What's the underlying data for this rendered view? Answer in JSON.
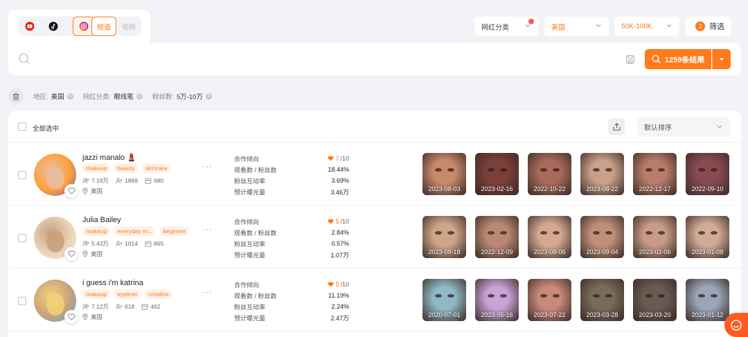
{
  "platforms": [
    {
      "name": "youtube-icon",
      "active": false
    },
    {
      "name": "tiktok-icon",
      "active": false
    },
    {
      "name": "instagram-icon",
      "active": true
    }
  ],
  "segments": {
    "channel": "频道",
    "video": "视频"
  },
  "filters": {
    "category": "网红分类",
    "region": "美国",
    "followers": "50K-100K",
    "filter_count": "3",
    "filter_label": "筛选"
  },
  "search": {
    "placeholder": "",
    "button": "1259条结果"
  },
  "applied": [
    {
      "label": "地区:",
      "value": "美国"
    },
    {
      "label": "网红分类:",
      "value": "眼线笔"
    },
    {
      "label": "粉丝数:",
      "value": "5万-10万"
    }
  ],
  "list": {
    "select_all": "全部选中",
    "sort": "默认排序",
    "metric_labels": [
      "合作倾向",
      "观看数 / 粉丝数",
      "粉丝互动率",
      "预计曝光量"
    ]
  },
  "influencers": [
    {
      "name": "jazzi manalo 💄",
      "tags": [
        "makeup",
        "beauty",
        "skincare"
      ],
      "followers": "7.19万",
      "following": "1869",
      "posts": "680",
      "location": "美国",
      "score": "7",
      "score_total": "/10",
      "ratio": "18.44%",
      "engagement": "3.69%",
      "exposure": "3.46万",
      "videos": [
        "2023-08-03",
        "2023-02-16",
        "2022-10-22",
        "2023-08-22",
        "2022-12-17",
        "2022-09-10"
      ],
      "palette": [
        "#c98a6b",
        "#7b3f3a",
        "#a86a5a",
        "#c9a18a",
        "#b87d6a",
        "#8a4a52"
      ],
      "avatar_colors": [
        "#ff9f3a",
        "#6a5acd",
        "#e8c0a0"
      ]
    },
    {
      "name": "Julia Bailey",
      "tags": [
        "makeup",
        "everyday m...",
        "beginner"
      ],
      "followers": "5.43万",
      "following": "1014",
      "posts": "865",
      "location": "美国",
      "score": "5",
      "score_total": "/10",
      "ratio": "2.84%",
      "engagement": "0.57%",
      "exposure": "1.07万",
      "videos": [
        "2023-09-18",
        "2022-12-09",
        "2023-08-06",
        "2023-09-04",
        "2023-02-06",
        "2023-01-08"
      ],
      "palette": [
        "#cfa58a",
        "#b98872",
        "#d6a892",
        "#bf9079",
        "#c79b86",
        "#d2ab96"
      ],
      "avatar_colors": [
        "#e9d3b8",
        "#f3e6d8",
        "#c7a07a"
      ]
    },
    {
      "name": "i guess i'm katrina",
      "tags": [
        "makeup",
        "eyeliner",
        "creative"
      ],
      "followers": "7.12万",
      "following": "618",
      "posts": "462",
      "location": "美国",
      "score": "5",
      "score_total": "/10",
      "ratio": "11.19%",
      "engagement": "2.24%",
      "exposure": "2.47万",
      "videos": [
        "2020-07-01",
        "2023-05-16",
        "2023-07-22",
        "2023-03-28",
        "2023-03-20",
        "2023-01-12"
      ],
      "palette": [
        "#8fb9c4",
        "#c7a3d6",
        "#c98a7a",
        "#7a6a5a",
        "#6a5a52",
        "#9aa6b8"
      ],
      "avatar_colors": [
        "#c9a27a",
        "#4aa8e8",
        "#f2d27a"
      ]
    }
  ]
}
